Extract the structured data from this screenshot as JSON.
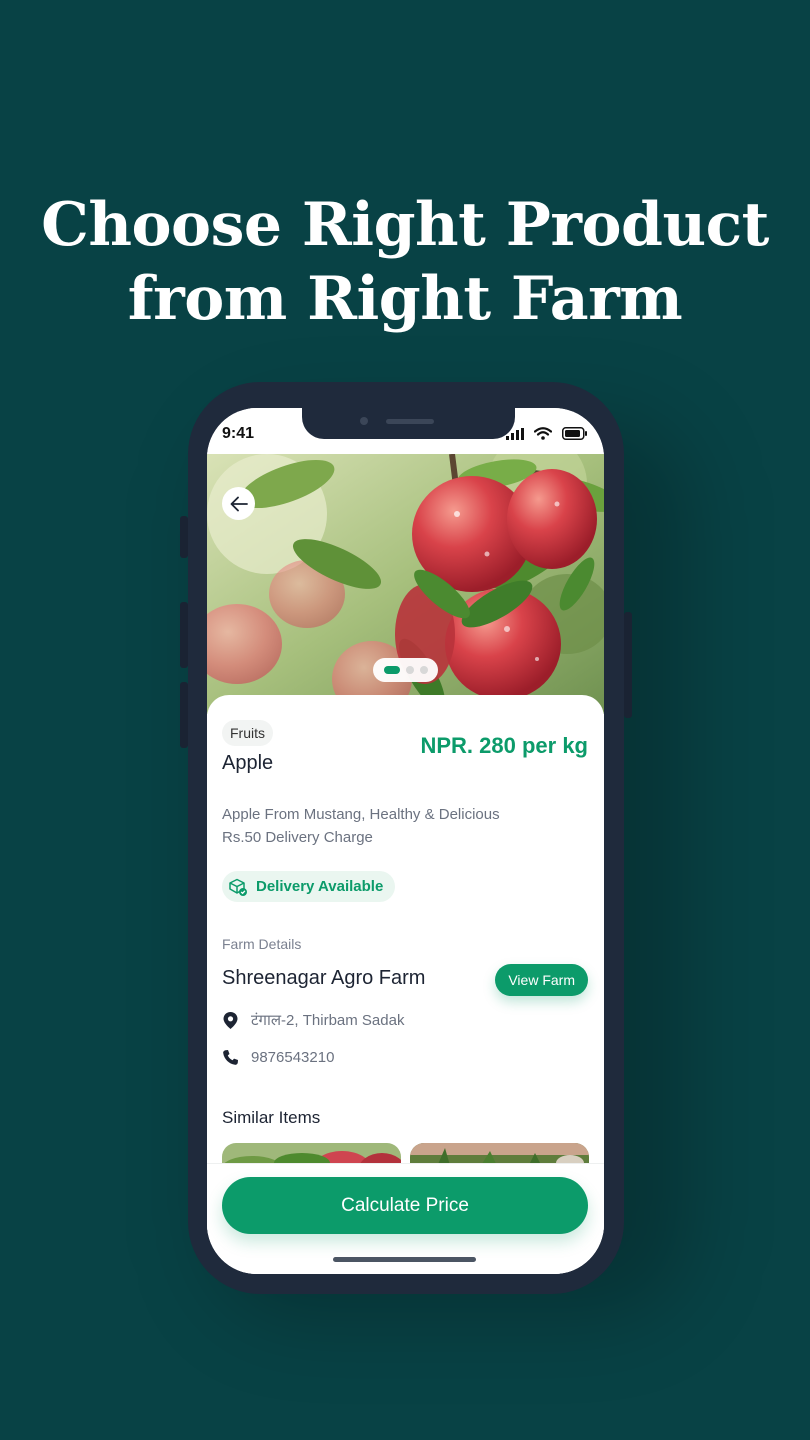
{
  "headline": {
    "line1": "Choose Right Product",
    "line2": "from Right Farm"
  },
  "status_bar": {
    "time": "9:41"
  },
  "product": {
    "category": "Fruits",
    "name": "Apple",
    "price": "NPR. 280 per kg",
    "description_line1": "Apple From Mustang, Healthy & Delicious",
    "description_line2": "Rs.50 Delivery Charge",
    "delivery_badge": "Delivery Available"
  },
  "farm": {
    "section_label": "Farm Details",
    "name": "Shreenagar Agro Farm",
    "view_button": "View Farm",
    "address": "टंगाल-2, Thirbam Sadak",
    "phone": "9876543210"
  },
  "similar": {
    "title": "Similar Items"
  },
  "carousel": {
    "total": 3,
    "active": 1
  },
  "cta": {
    "label": "Calculate Price"
  },
  "colors": {
    "background": "#084245",
    "accent": "#0c9b6a",
    "phone_frame": "#1f2a3c"
  },
  "icons": [
    "back-arrow-icon",
    "signal-icon",
    "wifi-icon",
    "battery-icon",
    "delivery-box-icon",
    "location-pin-icon",
    "phone-icon"
  ]
}
